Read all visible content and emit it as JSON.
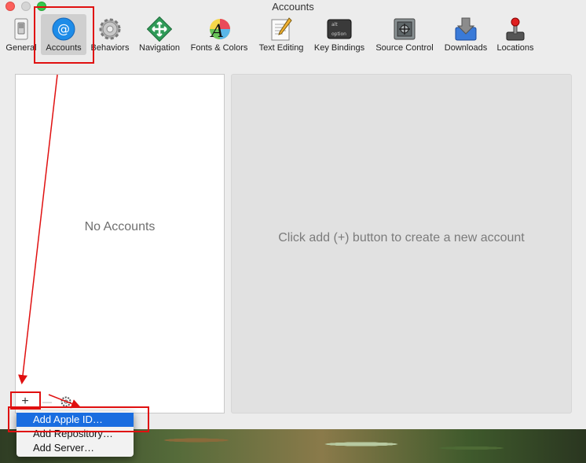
{
  "window": {
    "title": "Accounts"
  },
  "toolbar": {
    "items": [
      {
        "label": "General",
        "icon": "switch-icon"
      },
      {
        "label": "Accounts",
        "icon": "at-sign-icon"
      },
      {
        "label": "Behaviors",
        "icon": "gear-icon"
      },
      {
        "label": "Navigation",
        "icon": "navigation-icon"
      },
      {
        "label": "Fonts & Colors",
        "icon": "font-color-icon"
      },
      {
        "label": "Text Editing",
        "icon": "text-editing-icon"
      },
      {
        "label": "Key Bindings",
        "icon": "keyboard-key-icon"
      },
      {
        "label": "Source Control",
        "icon": "vault-icon"
      },
      {
        "label": "Downloads",
        "icon": "download-icon"
      },
      {
        "label": "Locations",
        "icon": "joystick-icon"
      }
    ],
    "selected": "Accounts"
  },
  "accounts_list": {
    "empty_text": "No Accounts"
  },
  "detail": {
    "hint": "Click add (+) button to create a new account"
  },
  "buttons": {
    "add": "+",
    "remove": "—"
  },
  "add_menu": {
    "items": [
      "Add Apple ID…",
      "Add Repository…",
      "Add Server…"
    ],
    "highlighted": "Add Apple ID…"
  },
  "colors": {
    "selection_blue": "#1a6de0",
    "annotation_red": "#e01010",
    "accounts_icon_blue": "#1e8ce8"
  }
}
